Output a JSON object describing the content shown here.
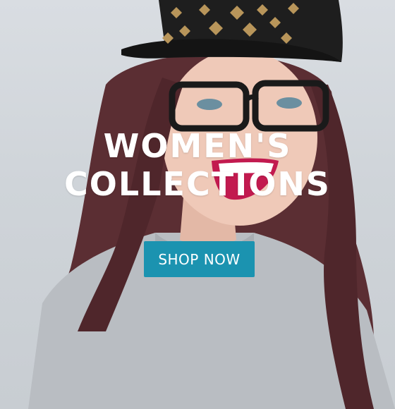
{
  "banner": {
    "headline_line1": "WOMEN'S",
    "headline_line2": "COLLECTIONS",
    "cta_label": "SHOP NOW"
  },
  "colors": {
    "cta_background": "#1b93b0",
    "headline_text": "#ffffff"
  },
  "image": {
    "subject": "woman-in-studded-cap-and-glasses"
  }
}
